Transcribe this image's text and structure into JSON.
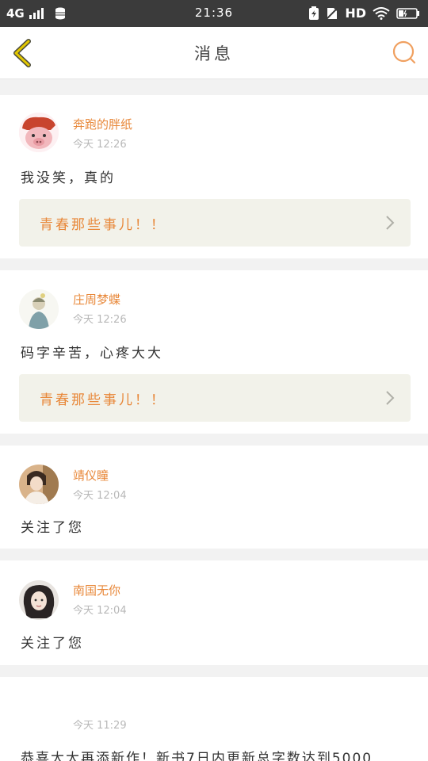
{
  "status": {
    "network": "4G",
    "time": "21:36",
    "hd": "HD"
  },
  "header": {
    "title": "消息",
    "icons": {
      "back": "chevron-left-icon",
      "search": "search-icon"
    }
  },
  "colors": {
    "accent": "#e8883a",
    "back_icon": "#e2c700",
    "link_bg": "#f2f2ea"
  },
  "messages": [
    {
      "name": "奔跑的胖纸",
      "time": "今天 12:26",
      "text": "我没笑，真的",
      "link": "青春那些事儿！！"
    },
    {
      "name": "庄周梦蝶",
      "time": "今天 12:26",
      "text": "码字辛苦，心疼大大",
      "link": "青春那些事儿！！"
    },
    {
      "name": "靖仪瞳",
      "time": "今天 12:04",
      "text": "关注了您"
    },
    {
      "name": "南国无你",
      "time": "今天 12:04",
      "text": "关注了您"
    },
    {
      "time": "今天 11:29",
      "text": "恭喜大大再添新作！新书7日内更新总字数达到5000"
    }
  ]
}
